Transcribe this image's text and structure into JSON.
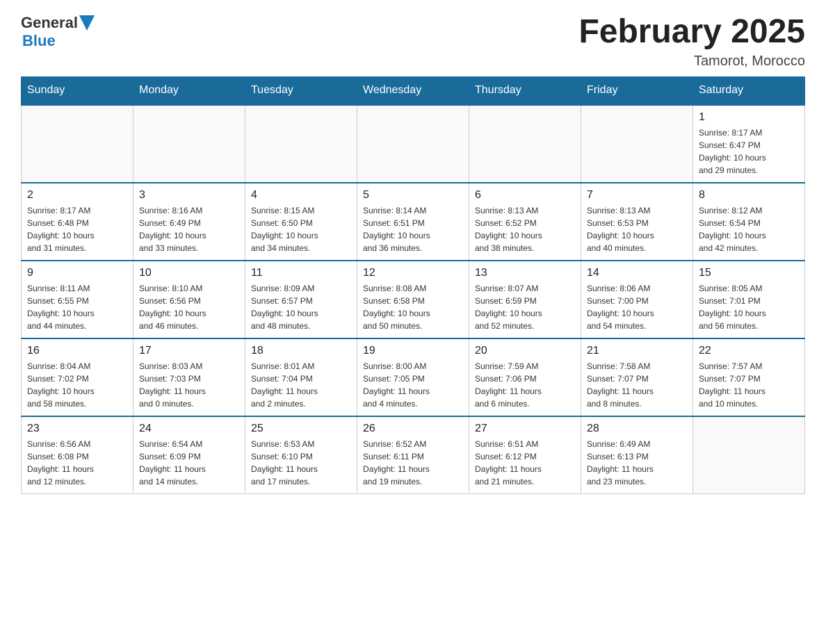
{
  "header": {
    "logo_general": "General",
    "logo_blue": "Blue",
    "month_title": "February 2025",
    "location": "Tamorot, Morocco"
  },
  "weekdays": [
    "Sunday",
    "Monday",
    "Tuesday",
    "Wednesday",
    "Thursday",
    "Friday",
    "Saturday"
  ],
  "weeks": [
    [
      {
        "day": "",
        "info": ""
      },
      {
        "day": "",
        "info": ""
      },
      {
        "day": "",
        "info": ""
      },
      {
        "day": "",
        "info": ""
      },
      {
        "day": "",
        "info": ""
      },
      {
        "day": "",
        "info": ""
      },
      {
        "day": "1",
        "info": "Sunrise: 8:17 AM\nSunset: 6:47 PM\nDaylight: 10 hours\nand 29 minutes."
      }
    ],
    [
      {
        "day": "2",
        "info": "Sunrise: 8:17 AM\nSunset: 6:48 PM\nDaylight: 10 hours\nand 31 minutes."
      },
      {
        "day": "3",
        "info": "Sunrise: 8:16 AM\nSunset: 6:49 PM\nDaylight: 10 hours\nand 33 minutes."
      },
      {
        "day": "4",
        "info": "Sunrise: 8:15 AM\nSunset: 6:50 PM\nDaylight: 10 hours\nand 34 minutes."
      },
      {
        "day": "5",
        "info": "Sunrise: 8:14 AM\nSunset: 6:51 PM\nDaylight: 10 hours\nand 36 minutes."
      },
      {
        "day": "6",
        "info": "Sunrise: 8:13 AM\nSunset: 6:52 PM\nDaylight: 10 hours\nand 38 minutes."
      },
      {
        "day": "7",
        "info": "Sunrise: 8:13 AM\nSunset: 6:53 PM\nDaylight: 10 hours\nand 40 minutes."
      },
      {
        "day": "8",
        "info": "Sunrise: 8:12 AM\nSunset: 6:54 PM\nDaylight: 10 hours\nand 42 minutes."
      }
    ],
    [
      {
        "day": "9",
        "info": "Sunrise: 8:11 AM\nSunset: 6:55 PM\nDaylight: 10 hours\nand 44 minutes."
      },
      {
        "day": "10",
        "info": "Sunrise: 8:10 AM\nSunset: 6:56 PM\nDaylight: 10 hours\nand 46 minutes."
      },
      {
        "day": "11",
        "info": "Sunrise: 8:09 AM\nSunset: 6:57 PM\nDaylight: 10 hours\nand 48 minutes."
      },
      {
        "day": "12",
        "info": "Sunrise: 8:08 AM\nSunset: 6:58 PM\nDaylight: 10 hours\nand 50 minutes."
      },
      {
        "day": "13",
        "info": "Sunrise: 8:07 AM\nSunset: 6:59 PM\nDaylight: 10 hours\nand 52 minutes."
      },
      {
        "day": "14",
        "info": "Sunrise: 8:06 AM\nSunset: 7:00 PM\nDaylight: 10 hours\nand 54 minutes."
      },
      {
        "day": "15",
        "info": "Sunrise: 8:05 AM\nSunset: 7:01 PM\nDaylight: 10 hours\nand 56 minutes."
      }
    ],
    [
      {
        "day": "16",
        "info": "Sunrise: 8:04 AM\nSunset: 7:02 PM\nDaylight: 10 hours\nand 58 minutes."
      },
      {
        "day": "17",
        "info": "Sunrise: 8:03 AM\nSunset: 7:03 PM\nDaylight: 11 hours\nand 0 minutes."
      },
      {
        "day": "18",
        "info": "Sunrise: 8:01 AM\nSunset: 7:04 PM\nDaylight: 11 hours\nand 2 minutes."
      },
      {
        "day": "19",
        "info": "Sunrise: 8:00 AM\nSunset: 7:05 PM\nDaylight: 11 hours\nand 4 minutes."
      },
      {
        "day": "20",
        "info": "Sunrise: 7:59 AM\nSunset: 7:06 PM\nDaylight: 11 hours\nand 6 minutes."
      },
      {
        "day": "21",
        "info": "Sunrise: 7:58 AM\nSunset: 7:07 PM\nDaylight: 11 hours\nand 8 minutes."
      },
      {
        "day": "22",
        "info": "Sunrise: 7:57 AM\nSunset: 7:07 PM\nDaylight: 11 hours\nand 10 minutes."
      }
    ],
    [
      {
        "day": "23",
        "info": "Sunrise: 6:56 AM\nSunset: 6:08 PM\nDaylight: 11 hours\nand 12 minutes."
      },
      {
        "day": "24",
        "info": "Sunrise: 6:54 AM\nSunset: 6:09 PM\nDaylight: 11 hours\nand 14 minutes."
      },
      {
        "day": "25",
        "info": "Sunrise: 6:53 AM\nSunset: 6:10 PM\nDaylight: 11 hours\nand 17 minutes."
      },
      {
        "day": "26",
        "info": "Sunrise: 6:52 AM\nSunset: 6:11 PM\nDaylight: 11 hours\nand 19 minutes."
      },
      {
        "day": "27",
        "info": "Sunrise: 6:51 AM\nSunset: 6:12 PM\nDaylight: 11 hours\nand 21 minutes."
      },
      {
        "day": "28",
        "info": "Sunrise: 6:49 AM\nSunset: 6:13 PM\nDaylight: 11 hours\nand 23 minutes."
      },
      {
        "day": "",
        "info": ""
      }
    ]
  ]
}
